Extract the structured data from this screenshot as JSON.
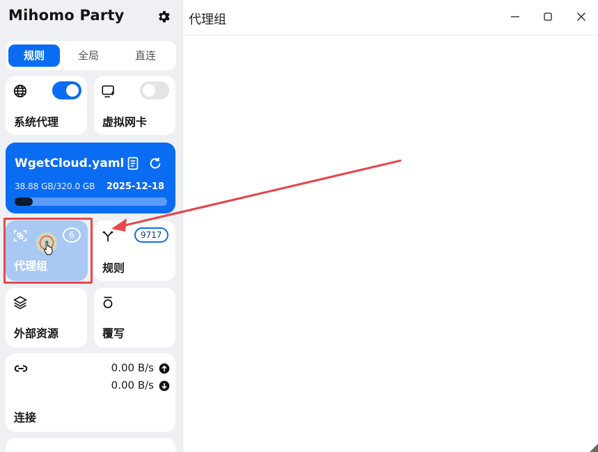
{
  "app": {
    "title": "Mihomo Party"
  },
  "mode_tabs": [
    {
      "label": "规则",
      "active": true
    },
    {
      "label": "全局",
      "active": false
    },
    {
      "label": "直连",
      "active": false
    }
  ],
  "system_proxy": {
    "label": "系统代理",
    "enabled": true
  },
  "tun": {
    "label": "虚拟网卡",
    "enabled": false
  },
  "profile": {
    "name": "WgetCloud.yaml",
    "usage": "38.88 GB/320.0 GB",
    "expire": "2025-12-18",
    "progress_fraction": 0.12
  },
  "proxy_groups": {
    "label": "代理组",
    "count": "6"
  },
  "rules": {
    "label": "规则",
    "count": "9717"
  },
  "resources": {
    "label": "外部资源"
  },
  "override": {
    "label": "覆写"
  },
  "connections": {
    "label": "连接",
    "upload": "0.00 B/s",
    "download": "0.00 B/s"
  },
  "main": {
    "title": "代理组"
  },
  "colors": {
    "accent": "#0a6cf2",
    "annotation": "#e5484d"
  },
  "icons": [
    "gear-icon",
    "globe-icon",
    "tun-icon",
    "document-icon",
    "refresh-icon",
    "proxy-group-icon",
    "rules-icon",
    "layers-icon",
    "override-icon",
    "link-icon",
    "upload-icon",
    "download-icon",
    "minimize-icon",
    "maximize-icon",
    "close-icon"
  ]
}
